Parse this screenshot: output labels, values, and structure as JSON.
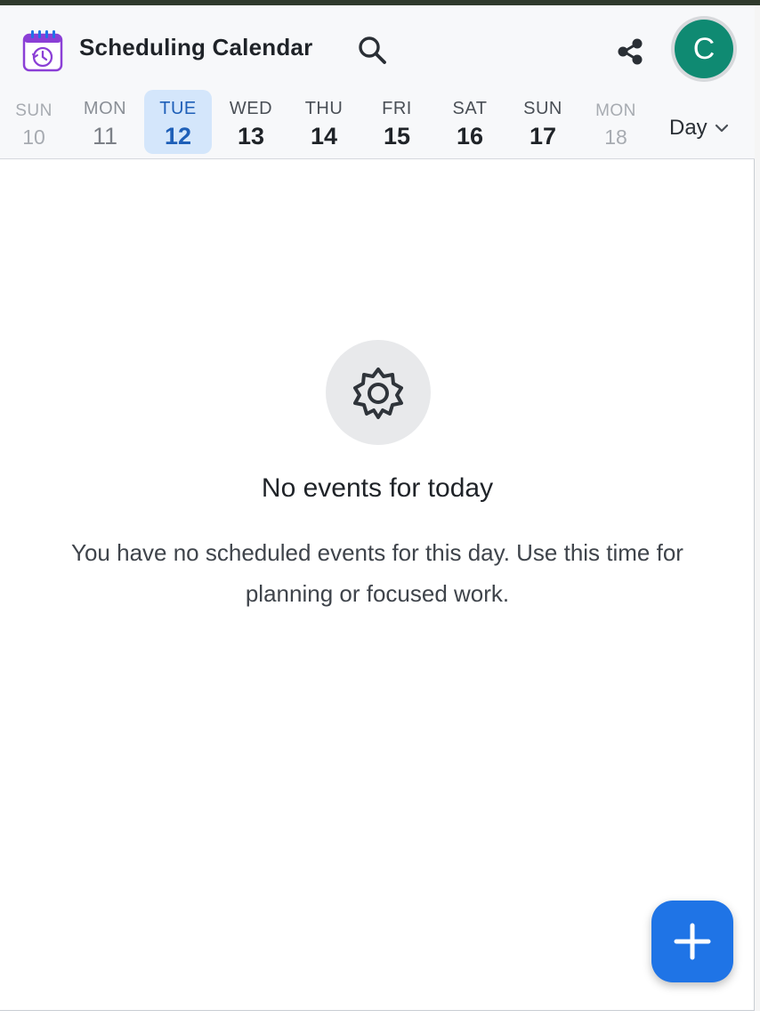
{
  "app": {
    "title": "Scheduling Calendar",
    "icon": "calendar-clock-icon"
  },
  "header": {
    "search_icon": "search-icon",
    "share_icon": "share-icon",
    "avatar_letter": "C",
    "avatar_color": "#0f8a72"
  },
  "week": {
    "days": [
      {
        "name": "SUN",
        "num": "10"
      },
      {
        "name": "MON",
        "num": "11"
      },
      {
        "name": "TUE",
        "num": "12"
      },
      {
        "name": "WED",
        "num": "13"
      },
      {
        "name": "THU",
        "num": "14"
      },
      {
        "name": "FRI",
        "num": "15"
      },
      {
        "name": "SAT",
        "num": "16"
      },
      {
        "name": "SUN",
        "num": "17"
      },
      {
        "name": "MON",
        "num": "18"
      }
    ],
    "selected_index": 2,
    "selected_color": "#1e5fb8"
  },
  "view": {
    "label": "Day",
    "icon": "chevron-down-icon"
  },
  "empty_state": {
    "icon": "gear-icon",
    "title": "No events for today",
    "description": "You have no scheduled events for this day. Use this time for planning or focused work."
  },
  "fab": {
    "icon": "plus-icon",
    "color": "#1f74e6"
  }
}
